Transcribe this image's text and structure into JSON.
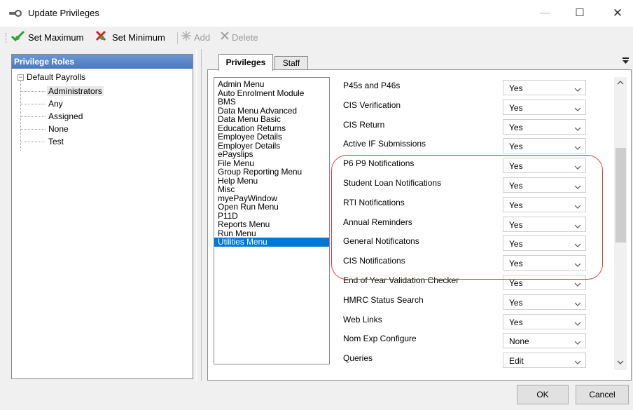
{
  "window": {
    "title": "Update Privileges",
    "icon": "key-icon",
    "minimize": "—",
    "maximize": "☐",
    "close": "✕"
  },
  "toolbar": {
    "set_maximum": "Set Maximum",
    "set_minimum": "Set Minimum",
    "add": "Add",
    "delete": "Delete"
  },
  "left_panel": {
    "header": "Privilege Roles",
    "root": "Default Payrolls",
    "expander": "−",
    "roles": [
      "Administrators",
      "Any",
      "Assigned",
      "None",
      "Test"
    ],
    "selected_role": "Administrators"
  },
  "tabs": {
    "privileges": "Privileges",
    "staff": "Staff",
    "active": "Privileges"
  },
  "menus": [
    "Admin Menu",
    "Auto Enrolment Module",
    "BMS",
    "Data Menu Advanced",
    "Data Menu Basic",
    "Education Returns",
    "Employee Details",
    "Employer Details",
    "ePayslips",
    "File Menu",
    "Group Reporting Menu",
    "Help Menu",
    "Misc",
    "myePayWindow",
    "Open Run Menu",
    "P11D",
    "Reports Menu",
    "Run Menu",
    "Utilities Menu"
  ],
  "selected_menu": "Utilities Menu",
  "privileges": [
    {
      "label": "P45s and P46s",
      "value": "Yes"
    },
    {
      "label": "CIS Verification",
      "value": "Yes"
    },
    {
      "label": "CIS Return",
      "value": "Yes"
    },
    {
      "label": "Active IF Submissions",
      "value": "Yes"
    },
    {
      "label": "P6 P9 Notifications",
      "value": "Yes"
    },
    {
      "label": "Student Loan Notifications",
      "value": "Yes"
    },
    {
      "label": "RTI Notifications",
      "value": "Yes"
    },
    {
      "label": "Annual Reminders",
      "value": "Yes"
    },
    {
      "label": "General Notificatons",
      "value": "Yes"
    },
    {
      "label": "CIS Notifications",
      "value": "Yes"
    },
    {
      "label": "End of Year Validation Checker",
      "value": "Yes"
    },
    {
      "label": "HMRC Status Search",
      "value": "Yes"
    },
    {
      "label": "Web Links",
      "value": "Yes"
    },
    {
      "label": "Nom Exp Configure",
      "value": "None"
    },
    {
      "label": "Queries",
      "value": "Edit"
    }
  ],
  "buttons": {
    "ok": "OK",
    "cancel": "Cancel"
  },
  "colors": {
    "selection": "#0078d7",
    "highlight_annotation": "#e23b3b",
    "header_blue": "#4a78c0"
  }
}
